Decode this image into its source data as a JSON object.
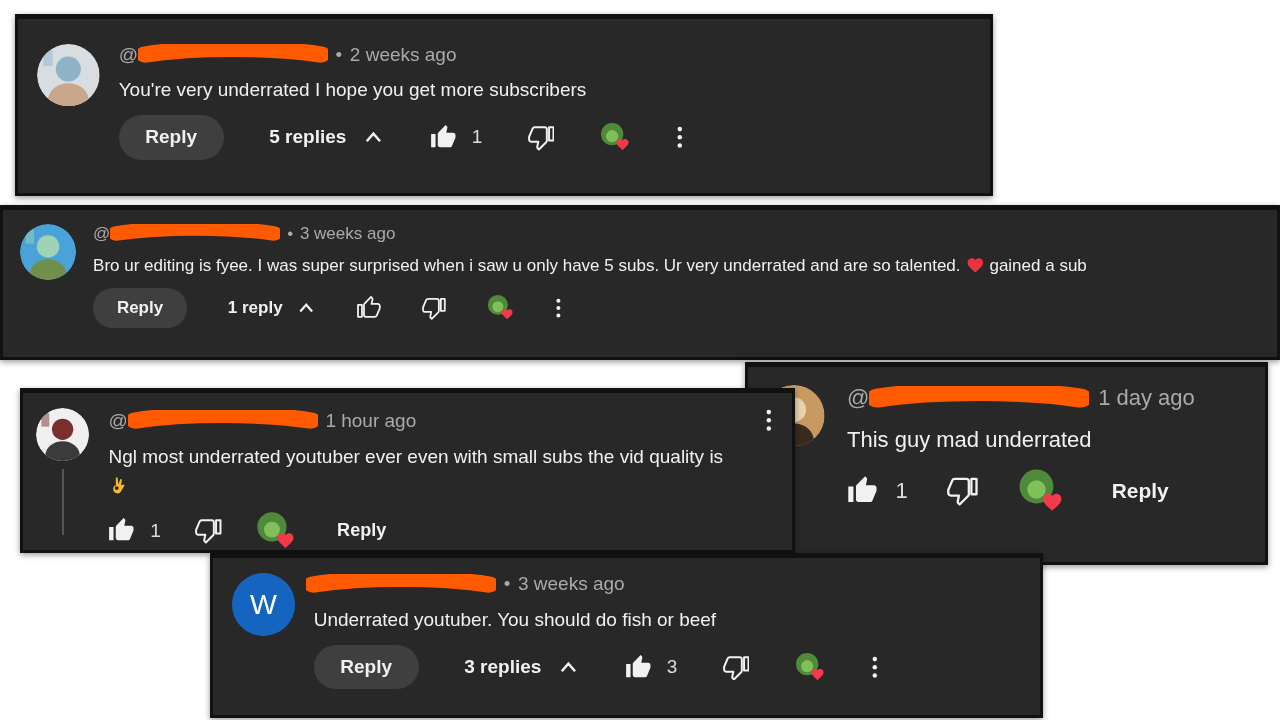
{
  "comments": [
    {
      "kind": "comment",
      "avatar": {
        "kind": "picture"
      },
      "handle": "@",
      "redacted": true,
      "dot": "•",
      "time": "2 weeks ago",
      "text": [
        {
          "kind": "text",
          "text": "You're very underrated I hope you get more subscribers"
        }
      ],
      "reply": "Reply",
      "replies": "5 replies",
      "expanded": true,
      "liked": true,
      "likes": "1",
      "creator_hearted": true,
      "menu": true
    },
    {
      "kind": "comment",
      "avatar": {
        "kind": "picture"
      },
      "handle": "@",
      "redacted": true,
      "dot": "•",
      "time": "3 weeks ago",
      "text": [
        {
          "kind": "text",
          "text": "Bro ur editing is fyee. I was super surprised when i saw u only have 5 subs. Ur very underrated and are so talented."
        },
        {
          "kind": "heart"
        },
        {
          "kind": "text",
          "text": "gained a sub"
        }
      ],
      "reply": "Reply",
      "replies": "1 reply",
      "expanded": true,
      "liked": false,
      "creator_hearted": true,
      "menu": true
    },
    {
      "kind": "reply",
      "avatar": {
        "kind": "picture"
      },
      "handle": "@",
      "redacted": true,
      "time": "1 hour ago",
      "text": [
        {
          "kind": "text",
          "text": "Ngl most underrated youtuber ever even with small subs the vid quality is"
        },
        {
          "kind": "ok_hand"
        }
      ],
      "reply": "Reply",
      "liked": true,
      "likes": "1",
      "creator_hearted": true,
      "menu": true
    },
    {
      "kind": "reply",
      "avatar": {
        "kind": "picture"
      },
      "handle": "@",
      "redacted": true,
      "time": "1 day ago",
      "text": [
        {
          "kind": "text",
          "text": "This guy mad underrated"
        }
      ],
      "reply": "Reply",
      "liked": true,
      "likes": "1",
      "creator_hearted": true,
      "menu": false
    },
    {
      "kind": "comment",
      "avatar": {
        "kind": "letter",
        "letter": "W"
      },
      "redacted": true,
      "dot": "•",
      "time": "3 weeks ago",
      "text": [
        {
          "kind": "text",
          "text": "Underrated youtuber. You should do fish or beef"
        }
      ],
      "reply": "Reply",
      "replies": "3 replies",
      "expanded": true,
      "liked": true,
      "likes": "3",
      "creator_hearted": true,
      "menu": true
    }
  ]
}
